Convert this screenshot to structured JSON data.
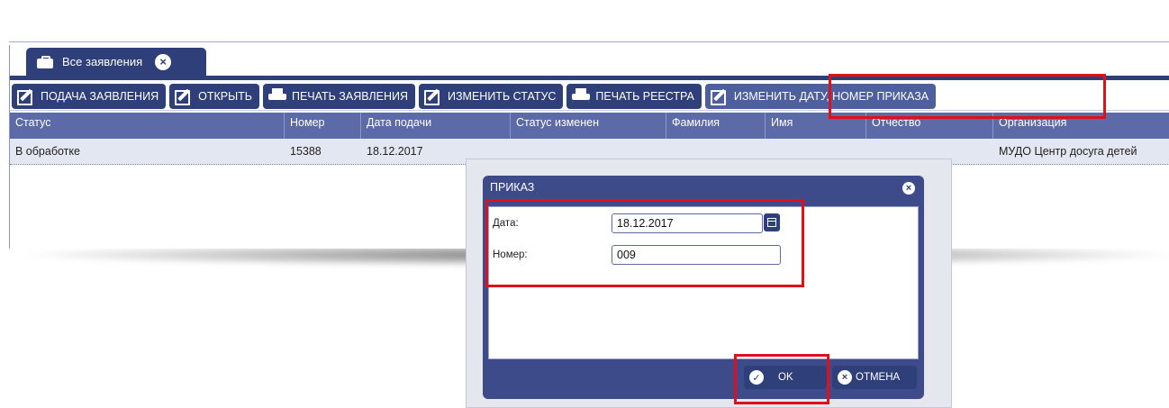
{
  "tab": {
    "label": "Все заявления"
  },
  "toolbar": {
    "buttons": [
      {
        "label": "ПОДАЧА ЗАЯВЛЕНИЯ",
        "icon": "edit-icon"
      },
      {
        "label": "ОТКРЫТЬ",
        "icon": "edit-icon"
      },
      {
        "label": "ПЕЧАТЬ ЗАЯВЛЕНИЯ",
        "icon": "print-icon"
      },
      {
        "label": "ИЗМЕНИТЬ СТАТУС",
        "icon": "edit-icon"
      },
      {
        "label": "ПЕЧАТЬ РЕЕСТРА",
        "icon": "print-icon"
      },
      {
        "label": "ИЗМЕНИТЬ ДАТУ, НОМЕР ПРИКАЗА",
        "icon": "edit-icon"
      }
    ]
  },
  "grid": {
    "columns": [
      "Статус",
      "Номер",
      "Дата подачи",
      "Статус изменен",
      "Фамилия",
      "Имя",
      "Отчество",
      "Организация"
    ],
    "rows": [
      [
        "В обработке",
        "15388",
        "18.12.2017",
        "",
        "",
        "",
        "",
        "МУДО Центр досуга детей"
      ]
    ]
  },
  "dialog": {
    "title": "ПРИКАЗ",
    "date_label": "Дата:",
    "date_value": "18.12.2017",
    "number_label": "Номер:",
    "number_value": "009",
    "ok_label": "OK",
    "cancel_label": "ОТМЕНА"
  },
  "colors": {
    "primary": "#2f3f7a",
    "header": "#5d6aa8",
    "row": "#e3e7f1",
    "highlight": "#e0101a"
  }
}
